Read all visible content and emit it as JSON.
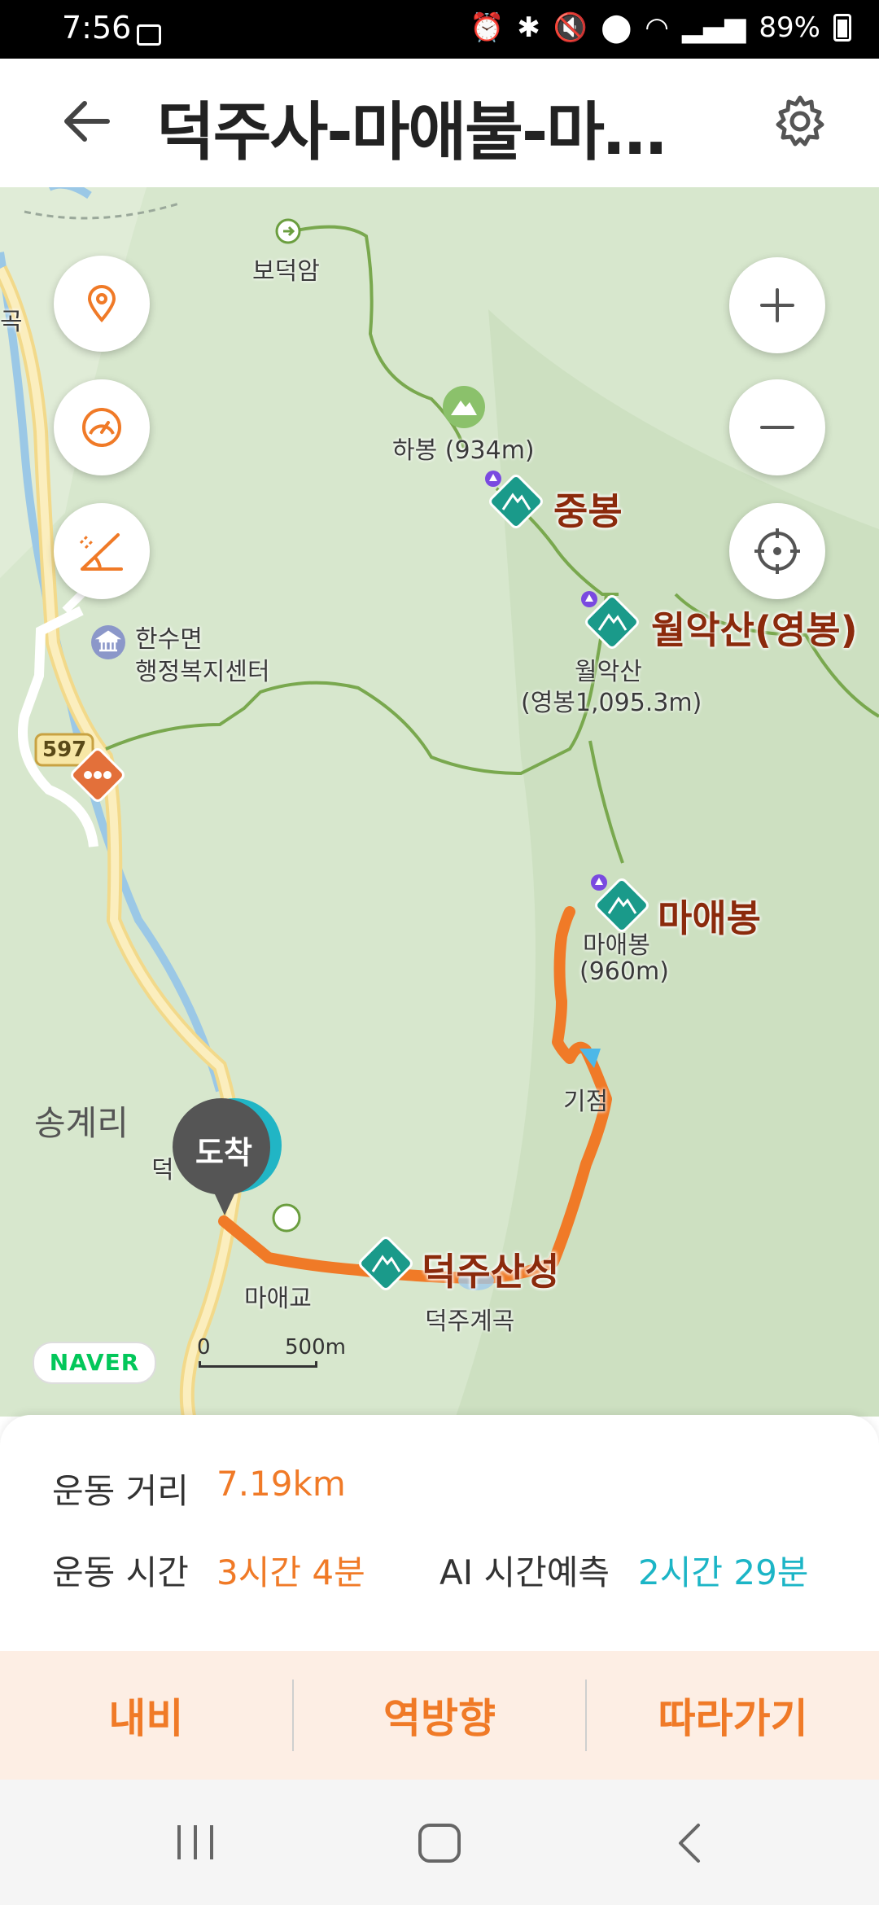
{
  "status_bar": {
    "time": "7:56",
    "battery": "89%",
    "icons": [
      "image-icon",
      "alarm-icon",
      "bluetooth-icon",
      "mute-icon",
      "location-icon",
      "wifi-icon",
      "hd-voice-icon",
      "signal-icon",
      "battery-icon"
    ]
  },
  "header": {
    "title": "덕주사-마애불-마애봉-월악산(영봉)",
    "back_icon": "back-arrow-icon",
    "settings_icon": "gear-icon"
  },
  "map": {
    "labels": {
      "bodeokam": "보덕암",
      "habong": "하봉 (934m)",
      "jungbong": "중봉",
      "worak": "월악산(영봉)",
      "worak_sub1": "월악산",
      "worak_sub2": "(영봉1,095.3m)",
      "hansu1": "한수면",
      "hansu2": "행정복지센터",
      "road_597": "597",
      "maebong": "마애봉",
      "maebong_sub1": "마애봉",
      "maebong_sub2": "(960m)",
      "gicheok": "기점",
      "songgye": "송계리",
      "deokju_partial": "덕",
      "deokjusanseong": "덕주산성",
      "maegyo": "마애교",
      "deokjugyegok": "덕주계곡",
      "left_edge_gok": "곡",
      "partial_top": "한수면"
    },
    "arrive_label": "도착",
    "naver_logo": "NAVER",
    "scale": {
      "start": "0",
      "end": "500m"
    },
    "route_color": "#f07a27"
  },
  "stats": {
    "distance_label": "운동 거리",
    "distance_value": "7.19km",
    "time_label": "운동 시간",
    "time_value": "3시간 4분",
    "ai_label": "AI 시간예측",
    "ai_value": "2시간 29분"
  },
  "actions": {
    "navi": "내비",
    "reverse": "역방향",
    "follow": "따라가기"
  }
}
